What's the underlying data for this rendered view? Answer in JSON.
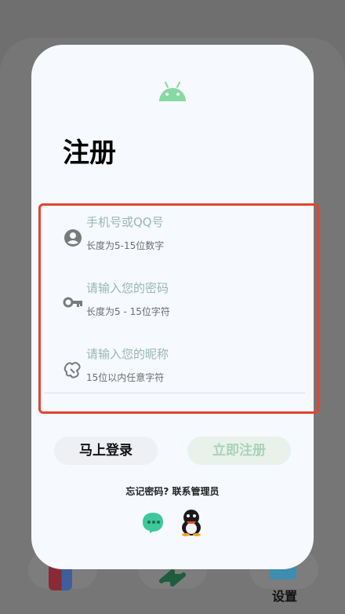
{
  "dialog": {
    "title": "注册",
    "fields": [
      {
        "icon": "account-circle-icon",
        "placeholder": "手机号或QQ号",
        "hint": "长度为5-15位数字"
      },
      {
        "icon": "key-icon",
        "placeholder": "请输入您的密码",
        "hint": "长度为5 - 15位字符"
      },
      {
        "icon": "nickname-icon",
        "placeholder": "请输入您的昵称",
        "hint": "15位以内任意字符"
      }
    ],
    "login_button": "马上登录",
    "register_button": "立即注册",
    "forgot_text": "忘记密码? 联系管理员",
    "social_icons": [
      "message-bubble-icon",
      "qq-penguin-icon"
    ]
  },
  "dock": {
    "settings_label": "设置"
  },
  "colors": {
    "accent_green": "#a9d2b7",
    "highlight_border": "#e2452e",
    "android_green": "#88d9a0"
  }
}
